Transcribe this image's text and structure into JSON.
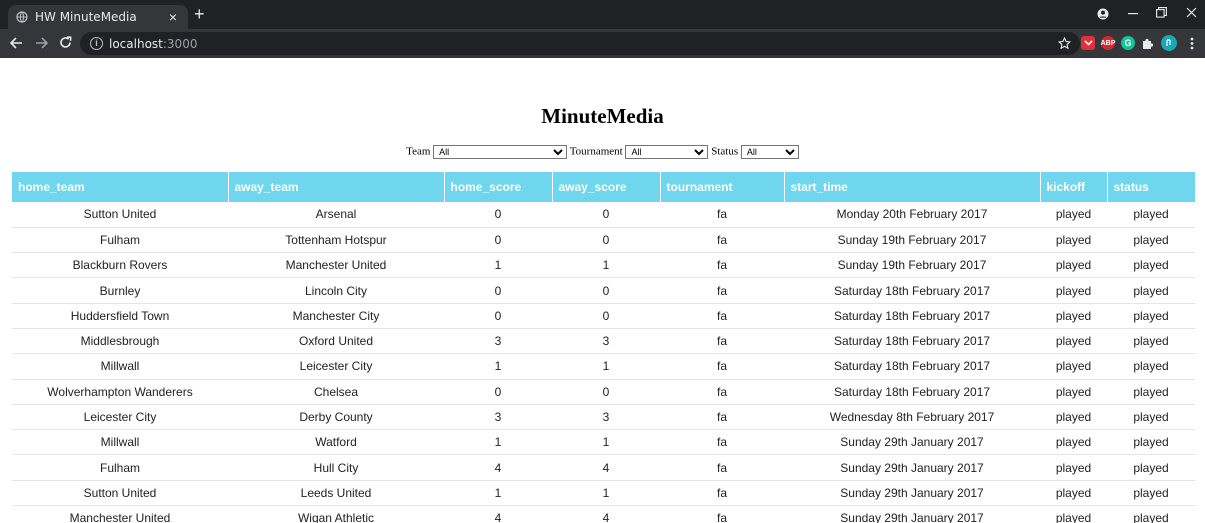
{
  "browser": {
    "tab_title": "HW MinuteMedia",
    "tab_close": "×",
    "new_tab": "+",
    "url_host": "localhost",
    "url_port": ":3000",
    "extensions": [
      {
        "icon": "pocket-icon",
        "label": "",
        "color": "#e0303c"
      },
      {
        "icon": "adblock-icon",
        "label": "ABP",
        "color": "#d8262e"
      },
      {
        "icon": "grammarly-icon",
        "label": "G",
        "color": "#15c39a"
      },
      {
        "icon": "puzzle-icon",
        "label": "",
        "color": "#35363a"
      },
      {
        "icon": "profile-avatar",
        "label": "",
        "color": "#1aa8b5"
      }
    ]
  },
  "page": {
    "title": "MinuteMedia"
  },
  "filters": {
    "team_label": "Team",
    "team_value": "All",
    "tournament_label": "Tournament",
    "tournament_value": "All",
    "status_label": "Status",
    "status_value": "All"
  },
  "table": {
    "columns": [
      "home_team",
      "away_team",
      "home_score",
      "away_score",
      "tournament",
      "start_time",
      "kickoff",
      "status"
    ],
    "rows": [
      [
        "Sutton United",
        "Arsenal",
        "0",
        "0",
        "fa",
        "Monday 20th February 2017",
        "played",
        "played"
      ],
      [
        "Fulham",
        "Tottenham Hotspur",
        "0",
        "0",
        "fa",
        "Sunday 19th February 2017",
        "played",
        "played"
      ],
      [
        "Blackburn Rovers",
        "Manchester United",
        "1",
        "1",
        "fa",
        "Sunday 19th February 2017",
        "played",
        "played"
      ],
      [
        "Burnley",
        "Lincoln City",
        "0",
        "0",
        "fa",
        "Saturday 18th February 2017",
        "played",
        "played"
      ],
      [
        "Huddersfield Town",
        "Manchester City",
        "0",
        "0",
        "fa",
        "Saturday 18th February 2017",
        "played",
        "played"
      ],
      [
        "Middlesbrough",
        "Oxford United",
        "3",
        "3",
        "fa",
        "Saturday 18th February 2017",
        "played",
        "played"
      ],
      [
        "Millwall",
        "Leicester City",
        "1",
        "1",
        "fa",
        "Saturday 18th February 2017",
        "played",
        "played"
      ],
      [
        "Wolverhampton Wanderers",
        "Chelsea",
        "0",
        "0",
        "fa",
        "Saturday 18th February 2017",
        "played",
        "played"
      ],
      [
        "Leicester City",
        "Derby County",
        "3",
        "3",
        "fa",
        "Wednesday 8th February 2017",
        "played",
        "played"
      ],
      [
        "Millwall",
        "Watford",
        "1",
        "1",
        "fa",
        "Sunday 29th January 2017",
        "played",
        "played"
      ],
      [
        "Fulham",
        "Hull City",
        "4",
        "4",
        "fa",
        "Sunday 29th January 2017",
        "played",
        "played"
      ],
      [
        "Sutton United",
        "Leeds United",
        "1",
        "1",
        "fa",
        "Sunday 29th January 2017",
        "played",
        "played"
      ],
      [
        "Manchester United",
        "Wigan Athletic",
        "4",
        "4",
        "fa",
        "Sunday 29th January 2017",
        "played",
        "played"
      ]
    ]
  },
  "colors": {
    "header_bg": "#6fd6ee",
    "chrome_dark": "#202124",
    "chrome_toolbar": "#35363a"
  }
}
